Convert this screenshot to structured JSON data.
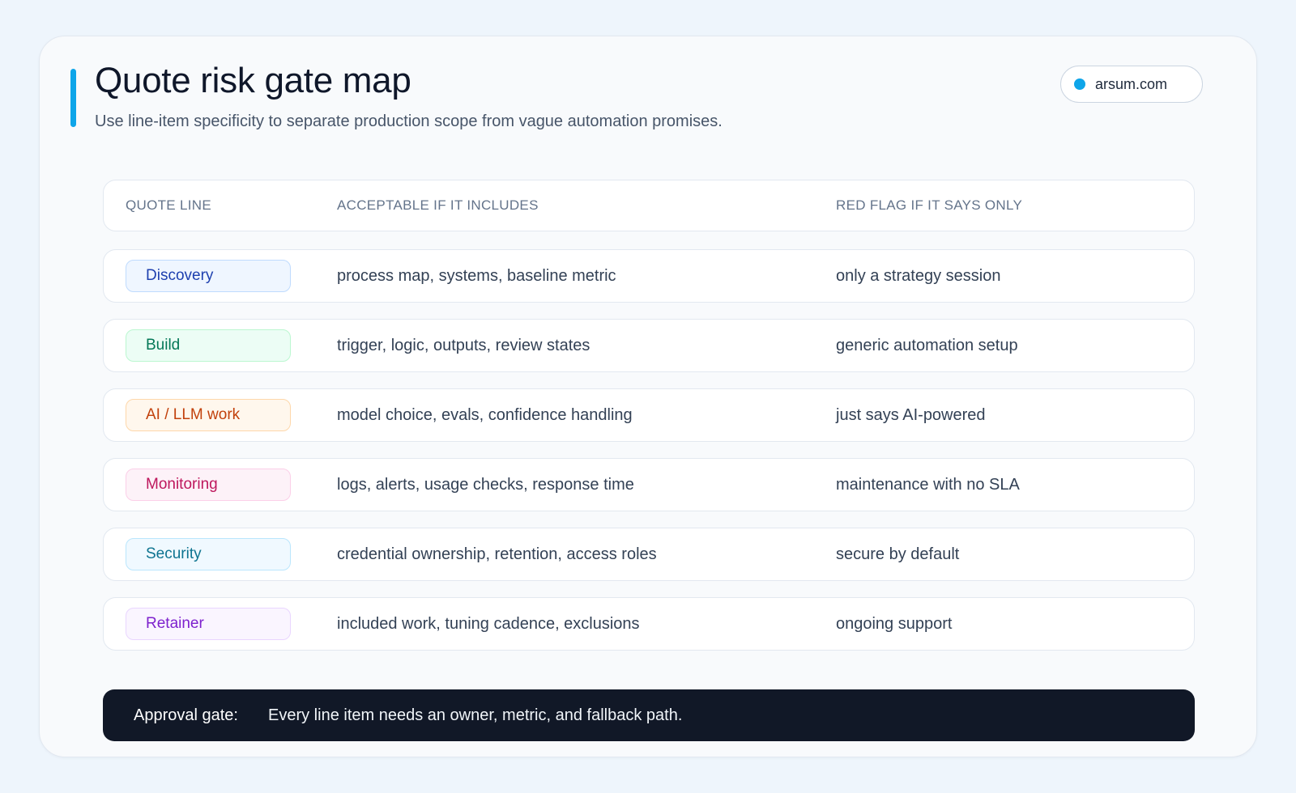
{
  "header": {
    "title": "Quote risk gate map",
    "subtitle": "Use line-item specificity to separate production scope from vague automation promises.",
    "domain_badge": "arsum.com",
    "accent_color": "#0ea5e9"
  },
  "table": {
    "columns": [
      "QUOTE LINE",
      "ACCEPTABLE IF IT INCLUDES",
      "RED FLAG IF IT SAYS ONLY"
    ],
    "rows": [
      {
        "label": "Discovery",
        "acceptable": "process map, systems, baseline metric",
        "red_flag": "only a strategy session",
        "text_color": "#1e40af",
        "bg_color": "#eff6ff",
        "border_color": "#bfdbfe"
      },
      {
        "label": "Build",
        "acceptable": "trigger, logic, outputs, review states",
        "red_flag": "generic automation setup",
        "text_color": "#047857",
        "bg_color": "#ecfdf5",
        "border_color": "#bbf7d0"
      },
      {
        "label": "AI / LLM work",
        "acceptable": "model choice, evals, confidence handling",
        "red_flag": "just says AI-powered",
        "text_color": "#c2410c",
        "bg_color": "#fff7ed",
        "border_color": "#fed7aa"
      },
      {
        "label": "Monitoring",
        "acceptable": "logs, alerts, usage checks, response time",
        "red_flag": "maintenance with no SLA",
        "text_color": "#be185d",
        "bg_color": "#fdf2f8",
        "border_color": "#fbcfe8"
      },
      {
        "label": "Security",
        "acceptable": "credential ownership, retention, access roles",
        "red_flag": "secure by default",
        "text_color": "#0e7490",
        "bg_color": "#f0f9ff",
        "border_color": "#bae6fd"
      },
      {
        "label": "Retainer",
        "acceptable": "included work, tuning cadence, exclusions",
        "red_flag": "ongoing support",
        "text_color": "#7e22ce",
        "bg_color": "#faf5ff",
        "border_color": "#e9d5ff"
      }
    ]
  },
  "footer": {
    "label": "Approval gate:",
    "text": "Every line item needs an owner, metric, and fallback path."
  }
}
